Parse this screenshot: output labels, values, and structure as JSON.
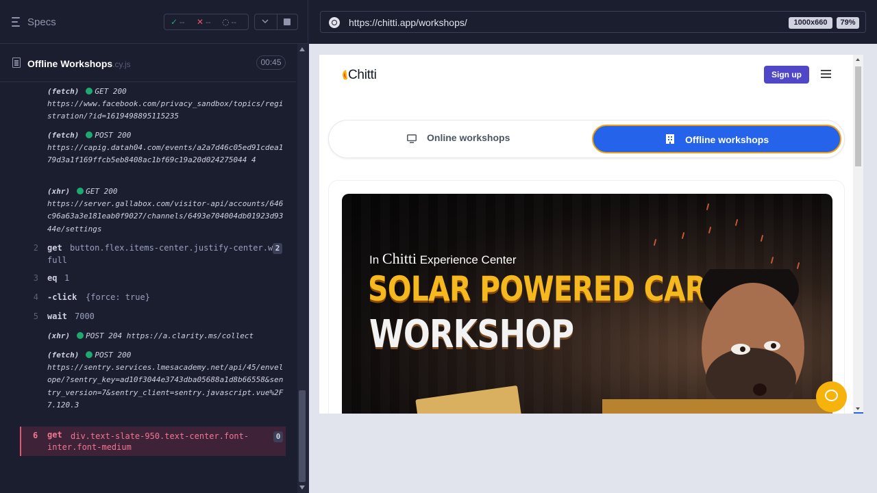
{
  "runner": {
    "specs_label": "Specs",
    "stats": {
      "passed": "--",
      "failed": "--",
      "pending": "--"
    },
    "spec": {
      "name": "Offline Workshops",
      "ext": ".cy.js",
      "duration": "00:45"
    },
    "network_logs": [
      {
        "kind": "(fetch)",
        "status": "GET 200",
        "url": "https://www.facebook.com/privacy_sandbox/topics/registration/?id=1619498895115235"
      },
      {
        "kind": "(fetch)",
        "status": "POST 200",
        "url": "https://capig.datah04.com/events/a2a7d46c05ed91cdea179d3a1f169ffcb5eb8408ac1bf69c19a20d024275044 4"
      },
      {
        "kind": "(xhr)",
        "status": "GET 200",
        "url": "https://server.gallabox.com/visitor-api/accounts/646c96a63a3e181eab0f9027/channels/6493e704004db01923d9344e/settings"
      }
    ],
    "commands": [
      {
        "num": "2",
        "name": "get",
        "arg": "button.flex.items-center.justify-center.w-",
        "arg2": "full",
        "badge": "2"
      },
      {
        "num": "3",
        "name": "eq",
        "arg": "1"
      },
      {
        "num": "4",
        "name": "-click",
        "arg": "{force: true}"
      },
      {
        "num": "5",
        "name": "wait",
        "arg": "7000"
      }
    ],
    "log_after_wait": {
      "kind": "(xhr)",
      "status": "POST 204",
      "url": "https://a.clarity.ms/collect"
    },
    "log_sentry": {
      "kind": "(fetch)",
      "status": "POST 200",
      "url": "https://sentry.services.lmesacademy.net/api/45/envelope/?sentry_key=ad10f3044e3743dba05688a1d8b66558&sentry_version=7&sentry_client=sentry.javascript.vue%2F7.120.3"
    },
    "failed_command": {
      "num": "6",
      "name": "get",
      "arg": "div.text-slate-950.text-center.font-",
      "arg2": "inter.font-medium",
      "badge": "0"
    }
  },
  "browser": {
    "url": "https://chitti.app/workshops/",
    "viewport": "1000x660",
    "zoom": "79%"
  },
  "site": {
    "logo": "Chitti",
    "signup": "Sign up",
    "tabs": {
      "online": "Online workshops",
      "offline": "Offline workshops"
    },
    "banner": {
      "in": "In",
      "brand": "Chitti",
      "center": "Experience Center",
      "line1": "SOLAR POWERED CAR",
      "line2": "WORKSHOP"
    }
  },
  "colors": {
    "accent": "#2563eb",
    "signup": "#4f46c8",
    "failed": "#e45770",
    "pass": "#1fa971",
    "chat": "#f5b30b"
  }
}
